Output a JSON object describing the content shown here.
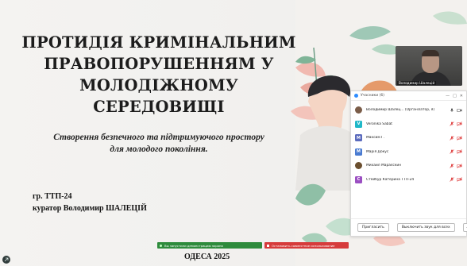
{
  "slide": {
    "title_lines": [
      "ПРОТИДІЯ КРИМІНАЛЬНИМ",
      "ПРАВОПОРУШЕННЯМ У",
      "МОЛОДІЖНОМУ",
      "СЕРЕДОВИЩІ"
    ],
    "subtitle_lines": [
      "Створення безпечного та підтримуючого простору",
      "для молодого покоління."
    ],
    "group": "гр. ТТП-24",
    "curator": "куратор Володимир ШАЛЕЦІЙ",
    "city_year": "ОДЕСА 2025"
  },
  "video": {
    "name": "Володимир Шалецій"
  },
  "participants_panel": {
    "title": "Учасники (6)",
    "participants": [
      {
        "initial": "",
        "name": "Володимир Шалец... (Організатор, я)",
        "avatar_color": "#7a5c48",
        "badge": "",
        "muted": false,
        "avatar": "photo"
      },
      {
        "initial": "V",
        "name": "Veronika Sabat",
        "avatar_color": "#1fb8c8",
        "muted": true,
        "avatar": "letter"
      },
      {
        "initial": "M",
        "name": "Максим Г.",
        "avatar_color": "#5b6bbd",
        "muted": true,
        "avatar": "letter"
      },
      {
        "initial": "M",
        "name": "Марія Докус",
        "avatar_color": "#4a7bd1",
        "muted": true,
        "avatar": "letter"
      },
      {
        "initial": "",
        "name": "Михаил Мараєскин",
        "avatar_color": "#6b4f2f",
        "muted": true,
        "avatar": "photo"
      },
      {
        "initial": "C",
        "name": "Стейбур Катерина ТТП-24",
        "avatar_color": "#9b4fc2",
        "muted": true,
        "avatar": "letter"
      }
    ],
    "invite_label": "Пригласить",
    "mute_all_label": "Выключить звук для всех",
    "more_label": "..."
  },
  "sharing": {
    "status": "Вы запустили демонстрацию экрана",
    "stop": "Остановить совместное использование"
  },
  "colors": {
    "share_green": "#2e8b3c",
    "stop_red": "#d63b3b",
    "accent_blue": "#2d8cff",
    "muted_red": "#e04646"
  }
}
